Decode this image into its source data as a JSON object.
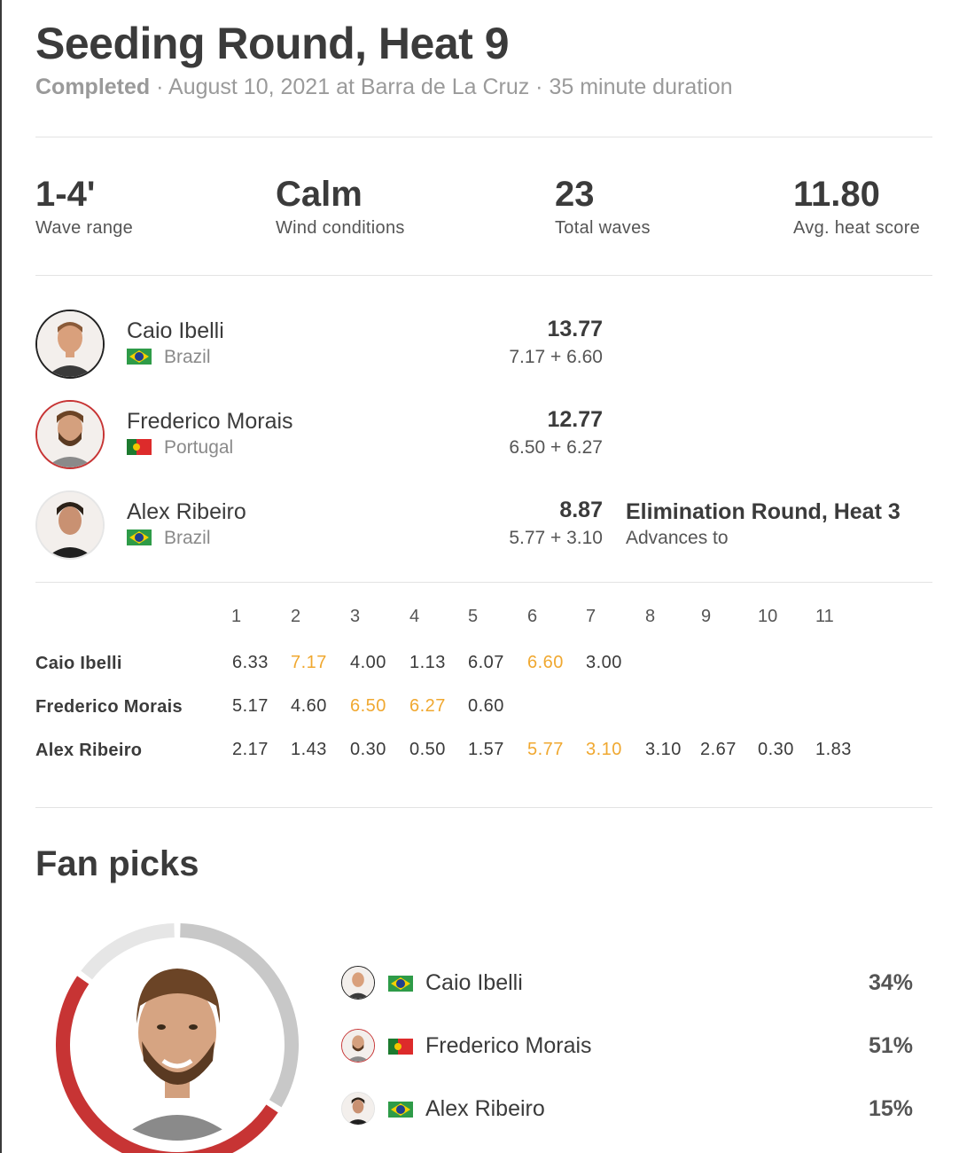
{
  "heat": {
    "title": "Seeding Round, Heat 9",
    "status": "Completed",
    "details": " · August 10, 2021 at Barra de La Cruz · 35 minute duration"
  },
  "stats": [
    {
      "value": "1-4'",
      "label": "Wave range"
    },
    {
      "value": "Calm",
      "label": "Wind conditions"
    },
    {
      "value": "23",
      "label": "Total waves"
    },
    {
      "value": "11.80",
      "label": "Avg. heat score"
    }
  ],
  "surfers": [
    {
      "name": "Caio Ibelli",
      "country": "Brazil",
      "total": "13.77",
      "breakdown": "7.17 + 6.60"
    },
    {
      "name": "Frederico Morais",
      "country": "Portugal",
      "total": "12.77",
      "breakdown": "6.50 + 6.27"
    },
    {
      "name": "Alex Ribeiro",
      "country": "Brazil",
      "total": "8.87",
      "breakdown": "5.77 + 3.10",
      "advances_title": "Elimination Round, Heat 3",
      "advances_label": "Advances to"
    }
  ],
  "wave_scores": {
    "wave_numbers": [
      "1",
      "2",
      "3",
      "4",
      "5",
      "6",
      "7",
      "8",
      "9",
      "10",
      "11"
    ],
    "rows": [
      {
        "name": "Caio Ibelli",
        "scores": [
          "6.33",
          "7.17",
          "4.00",
          "1.13",
          "6.07",
          "6.60",
          "3.00"
        ],
        "counting": [
          1,
          5
        ]
      },
      {
        "name": "Frederico Morais",
        "scores": [
          "5.17",
          "4.60",
          "6.50",
          "6.27",
          "0.60"
        ],
        "counting": [
          2,
          3
        ]
      },
      {
        "name": "Alex Ribeiro",
        "scores": [
          "2.17",
          "1.43",
          "0.30",
          "0.50",
          "1.57",
          "5.77",
          "3.10",
          "3.10",
          "2.67",
          "0.30",
          "1.83"
        ],
        "counting": [
          5,
          6
        ]
      }
    ]
  },
  "fan_picks": {
    "title": "Fan picks",
    "picks": [
      {
        "name": "Caio Ibelli",
        "percent": "34%",
        "value": 34
      },
      {
        "name": "Frederico Morais",
        "percent": "51%",
        "value": 51
      },
      {
        "name": "Alex Ribeiro",
        "percent": "15%",
        "value": 15
      }
    ]
  },
  "colors": {
    "highlight": "#f0a830",
    "ring_red": "#c73434",
    "ring_gray": "#c8c8c8",
    "ring_light": "#e6e6e6"
  },
  "icons": [
    "avatar-photo",
    "brazil-flag-icon",
    "portugal-flag-icon"
  ]
}
